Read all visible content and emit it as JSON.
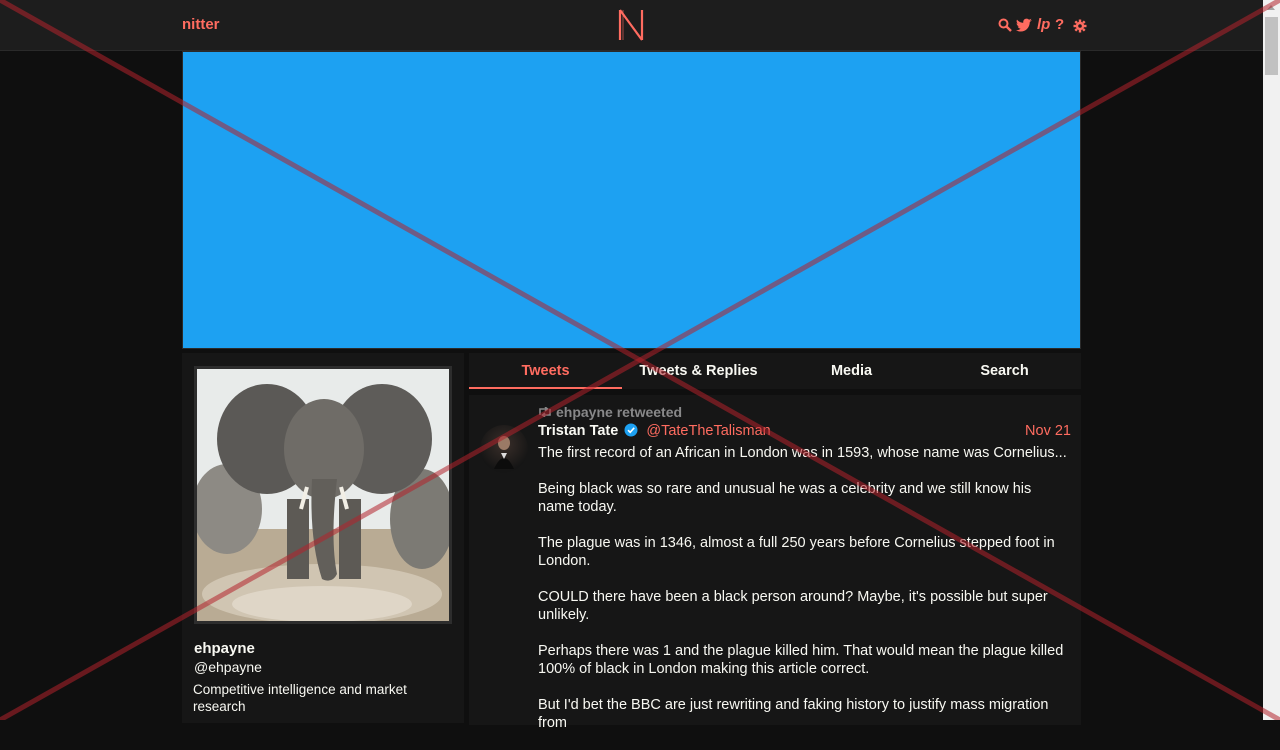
{
  "nav": {
    "brand": "nitter",
    "icons": [
      "search-icon",
      "twitter-icon",
      "rss-icon",
      "help-icon",
      "gear-icon"
    ],
    "help_glyph": "?",
    "rss_glyph": "lp"
  },
  "colors": {
    "accent": "#ff6c60",
    "banner": "#1da1f2",
    "background": "#0f0f0f",
    "panel": "#161616"
  },
  "profile": {
    "fullname": "ehpayne",
    "username": "@ehpayne",
    "bio": "Competitive intelligence and market research"
  },
  "tabs": [
    {
      "label": "Tweets",
      "active": true
    },
    {
      "label": "Tweets & Replies",
      "active": false
    },
    {
      "label": "Media",
      "active": false
    },
    {
      "label": "Search",
      "active": false
    }
  ],
  "tweet": {
    "retweet_label": "ehpayne retweeted",
    "fullname": "Tristan Tate",
    "handle": "@TateTheTalisman",
    "date": "Nov 21",
    "paragraphs": [
      "The first record of an African in London was in 1593, whose name was Cornelius...",
      "Being black was so rare and unusual he was a celebrity and we still know his name today.",
      "The plague was in 1346, almost a full 250 years before Cornelius stepped foot in London.",
      "COULD there have been a black person around? Maybe, it's possible but super unlikely.",
      "Perhaps there was 1 and the plague killed him. That would mean the plague killed 100% of black in London making this article correct.",
      "But I'd bet the BBC are just rewriting and faking history to justify mass migration from"
    ]
  }
}
